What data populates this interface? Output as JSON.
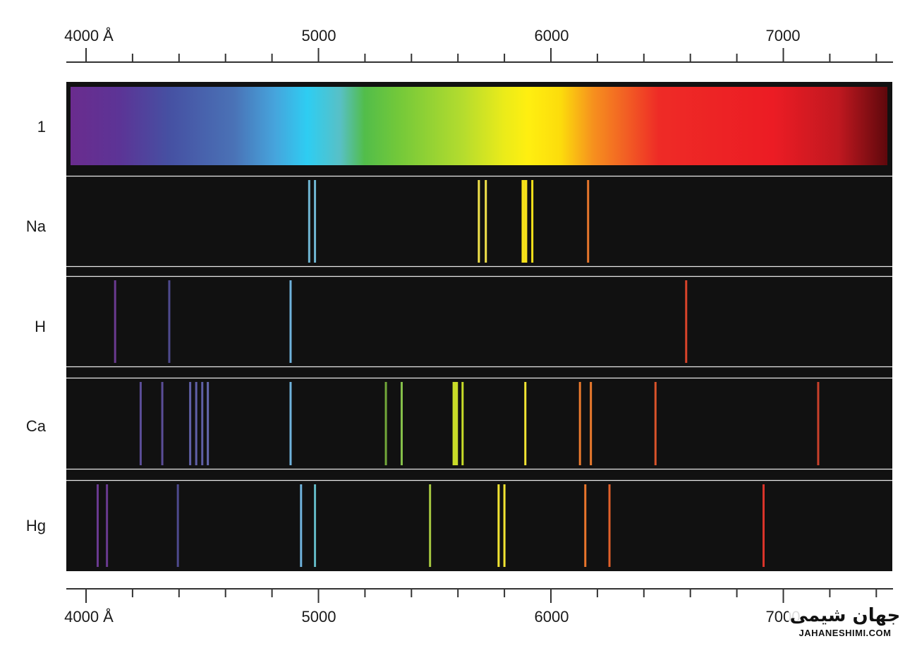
{
  "axis": {
    "unit": "Å",
    "min": 3920,
    "max": 7470,
    "major_ticks": [
      4000,
      5000,
      6000,
      7000
    ],
    "minor_tick_step": 200,
    "top_labels": [
      "4000 Å",
      "5000",
      "6000",
      "7000"
    ],
    "bottom_labels": [
      "4000 Å",
      "5000",
      "6000",
      "7000"
    ]
  },
  "continuous": {
    "label": "1"
  },
  "spectra": [
    {
      "label": "Na",
      "lines": [
        {
          "wl": 4960,
          "color": "#6fb6d2"
        },
        {
          "wl": 4985,
          "color": "#6fb6d2"
        },
        {
          "wl": 5690,
          "color": "#f2e34a"
        },
        {
          "wl": 5720,
          "color": "#f2e34a"
        },
        {
          "wl": 5880,
          "color": "#f7e21a",
          "width": 4
        },
        {
          "wl": 5892,
          "color": "#f7e21a",
          "width": 4
        },
        {
          "wl": 5920,
          "color": "#f7e21a"
        },
        {
          "wl": 6160,
          "color": "#e8762c"
        }
      ]
    },
    {
      "label": "H",
      "lines": [
        {
          "wl": 4125,
          "color": "#6a3a90"
        },
        {
          "wl": 4358,
          "color": "#4e4a8e"
        },
        {
          "wl": 4880,
          "color": "#6fb2dc"
        },
        {
          "wl": 6582,
          "color": "#d9432a"
        }
      ]
    },
    {
      "label": "Ca",
      "lines": [
        {
          "wl": 4235,
          "color": "#5b4e98"
        },
        {
          "wl": 4328,
          "color": "#5b4e98"
        },
        {
          "wl": 4448,
          "color": "#6060a8"
        },
        {
          "wl": 4474,
          "color": "#6060a8"
        },
        {
          "wl": 4500,
          "color": "#6060a8"
        },
        {
          "wl": 4524,
          "color": "#6468ae"
        },
        {
          "wl": 4880,
          "color": "#6fb2dc"
        },
        {
          "wl": 5290,
          "color": "#72a83a"
        },
        {
          "wl": 5358,
          "color": "#86c04a"
        },
        {
          "wl": 5583,
          "color": "#c8dc28",
          "width": 4
        },
        {
          "wl": 5594,
          "color": "#c8dc28",
          "width": 4
        },
        {
          "wl": 5620,
          "color": "#c8dc28"
        },
        {
          "wl": 5890,
          "color": "#f2e432"
        },
        {
          "wl": 6125,
          "color": "#ea7a2e"
        },
        {
          "wl": 6172,
          "color": "#ea7a2e"
        },
        {
          "wl": 6450,
          "color": "#d9532a"
        },
        {
          "wl": 7150,
          "color": "#c8402a"
        }
      ]
    },
    {
      "label": "Hg",
      "lines": [
        {
          "wl": 4050,
          "color": "#6a3a90"
        },
        {
          "wl": 4090,
          "color": "#6a3a90"
        },
        {
          "wl": 4395,
          "color": "#4e4a8e"
        },
        {
          "wl": 4925,
          "color": "#6fb2dc"
        },
        {
          "wl": 4985,
          "color": "#62b8c4"
        },
        {
          "wl": 5480,
          "color": "#a6c840"
        },
        {
          "wl": 5775,
          "color": "#f2e432"
        },
        {
          "wl": 5800,
          "color": "#f2e432"
        },
        {
          "wl": 6148,
          "color": "#ea762c"
        },
        {
          "wl": 6252,
          "color": "#e0602a"
        },
        {
          "wl": 6915,
          "color": "#d9342a"
        }
      ]
    }
  ],
  "watermark": {
    "brand": "جهان شیمی",
    "url": "JAHANESHIMI.COM"
  }
}
